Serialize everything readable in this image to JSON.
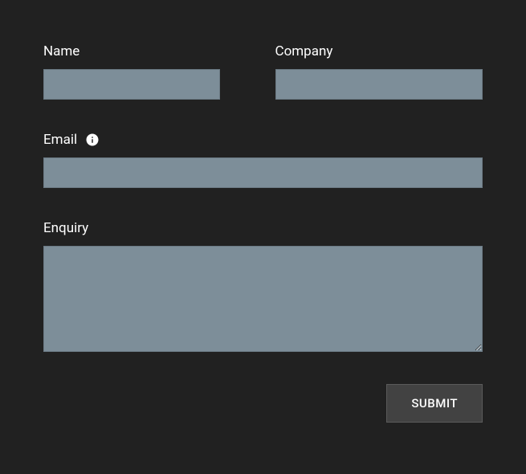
{
  "form": {
    "name": {
      "label": "Name",
      "value": ""
    },
    "company": {
      "label": "Company",
      "value": ""
    },
    "email": {
      "label": "Email",
      "value": ""
    },
    "enquiry": {
      "label": "Enquiry",
      "value": ""
    },
    "submit_label": "SUBMIT"
  }
}
